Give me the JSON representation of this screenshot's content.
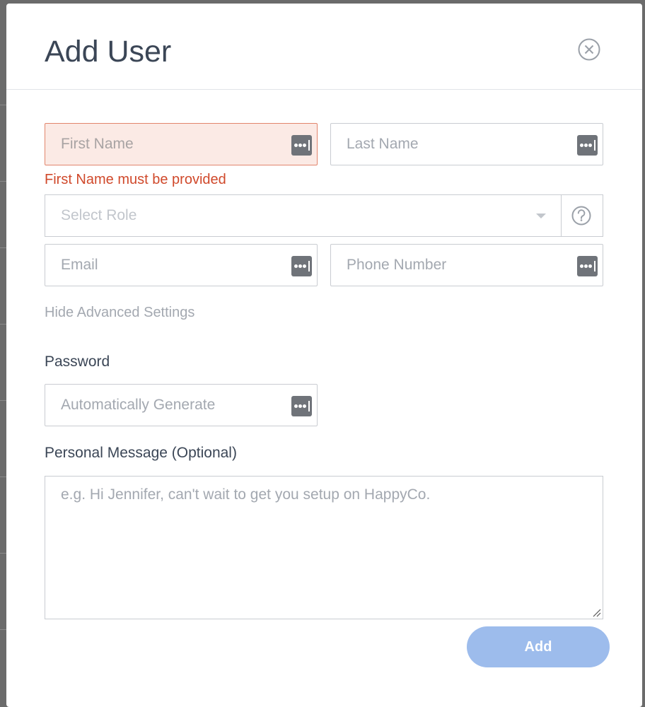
{
  "modal": {
    "title": "Add User",
    "close_icon": "close-circle-icon"
  },
  "form": {
    "first_name": {
      "placeholder": "First Name",
      "value": "",
      "error": "First Name must be provided"
    },
    "last_name": {
      "placeholder": "Last Name",
      "value": ""
    },
    "role": {
      "placeholder": "Select Role",
      "icon": "chevron-down-icon",
      "help_icon": "question-circle-icon"
    },
    "email": {
      "placeholder": "Email",
      "value": ""
    },
    "phone": {
      "placeholder": "Phone Number",
      "value": ""
    },
    "advanced_toggle": "Hide Advanced Settings",
    "password": {
      "label": "Password",
      "placeholder": "Automatically Generate",
      "value": ""
    },
    "message": {
      "label": "Personal Message (Optional)",
      "placeholder": "e.g. Hi Jennifer, can't wait to get you setup on HappyCo."
    },
    "password_manager_icon": "password-manager-icon",
    "submit_label": "Add"
  },
  "colors": {
    "title": "#3b4656",
    "error": "#d0492b",
    "error_bg": "#fbeae5",
    "primary_button": "#9dbcec"
  }
}
